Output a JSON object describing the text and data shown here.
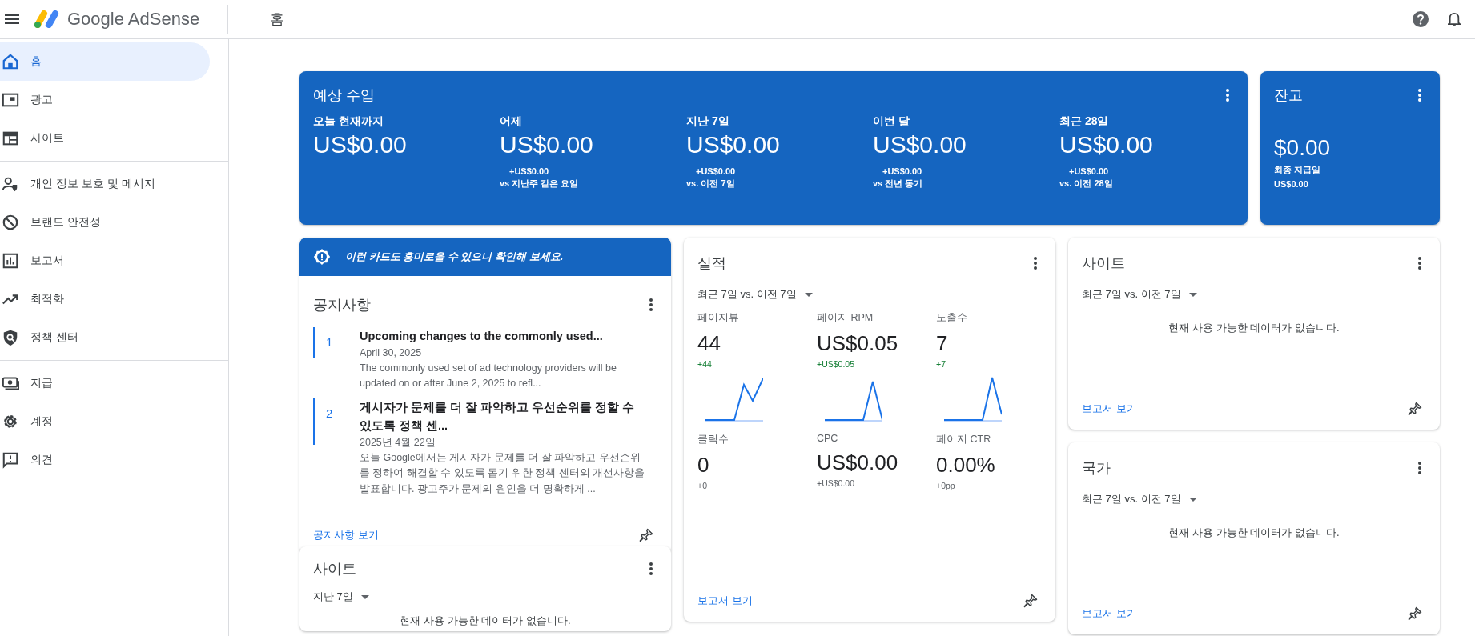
{
  "topbar": {
    "product": "Google AdSense",
    "page_title": "홈"
  },
  "sidebar": {
    "groups": [
      {
        "items": [
          {
            "label": "홈",
            "selected": true
          },
          {
            "label": "광고",
            "selected": false
          },
          {
            "label": "사이트",
            "selected": false
          }
        ]
      },
      {
        "items": [
          {
            "label": "개인 정보 보호 및 메시지",
            "selected": false
          },
          {
            "label": "브랜드 안전성",
            "selected": false
          },
          {
            "label": "보고서",
            "selected": false
          },
          {
            "label": "최적화",
            "selected": false
          },
          {
            "label": "정책 센터",
            "selected": false
          }
        ]
      },
      {
        "items": [
          {
            "label": "지급",
            "selected": false
          },
          {
            "label": "계정",
            "selected": false
          },
          {
            "label": "의견",
            "selected": false
          }
        ]
      }
    ]
  },
  "earnings": {
    "title": "예상 수입",
    "columns": [
      {
        "label": "오늘 현재까지",
        "amount": "US$0.00"
      },
      {
        "label": "어제",
        "amount": "US$0.00",
        "change": "+US$0.00",
        "comparison": "vs 지난주 같은 요일"
      },
      {
        "label": "지난 7일",
        "amount": "US$0.00",
        "change": "+US$0.00",
        "comparison": "vs. 이전 7일"
      },
      {
        "label": "이번 달",
        "amount": "US$0.00",
        "change": "+US$0.00",
        "comparison": "vs 전년 동기"
      },
      {
        "label": "최근 28일",
        "amount": "US$0.00",
        "change": "+US$0.00",
        "comparison": "vs. 이전 28일"
      }
    ]
  },
  "balance": {
    "title": "잔고",
    "amount": "$0.00",
    "caption": "최종 지급일",
    "last_payment": "US$0.00"
  },
  "notice_banner": {
    "text": "이런 카드도 흥미로울 수 있으니 확인해 보세요."
  },
  "announcements": {
    "title": "공지사항",
    "items": [
      {
        "number": "1",
        "title": "Upcoming changes to the commonly used...",
        "date": "April 30, 2025",
        "summary": "The commonly used set of ad technology providers will be updated on or after June 2, 2025 to refl..."
      },
      {
        "number": "2",
        "title": "게시자가 문제를 더 잘 파악하고 우선순위를 정할 수 있도록 정책 센...",
        "date": "2025년 4월 22일",
        "summary": "오늘 Google에서는 게시자가 문제를 더 잘 파악하고 우선순위를 정하여 해결할 수 있도록 돕기 위한 정책 센터의 개선사항을 발표합니다. 광고주가 문제의 원인을 더 명확하게 ..."
      }
    ],
    "link": "공지사항 보기"
  },
  "sites_small": {
    "title": "사이트",
    "range": "지난 7일",
    "empty": "현재 사용 가능한 데이터가 없습니다."
  },
  "performance": {
    "title": "실적",
    "range": "최근 7일 vs. 이전 7일",
    "metrics": [
      {
        "label": "페이지뷰",
        "value": "44",
        "change": "+44",
        "increase": true
      },
      {
        "label": "페이지 RPM",
        "value": "US$0.05",
        "change": "+US$0.05",
        "increase": true
      },
      {
        "label": "노출수",
        "value": "7",
        "change": "+7",
        "increase": true
      },
      {
        "label": "클릭수",
        "value": "0",
        "change": "+0",
        "increase": false
      },
      {
        "label": "CPC",
        "value": "US$0.00",
        "change": "+US$0.00",
        "increase": false
      },
      {
        "label": "페이지 CTR",
        "value": "0.00%",
        "change": "+0pp",
        "increase": false
      }
    ],
    "link": "보고서 보기"
  },
  "sites": {
    "title": "사이트",
    "range": "최근 7일 vs. 이전 7일",
    "empty": "현재 사용 가능한 데이터가 없습니다.",
    "link": "보고서 보기"
  },
  "countries": {
    "title": "국가",
    "range": "최근 7일 vs. 이전 7일",
    "empty": "현재 사용 가능한 데이터가 없습니다.",
    "link": "보고서 보기"
  }
}
